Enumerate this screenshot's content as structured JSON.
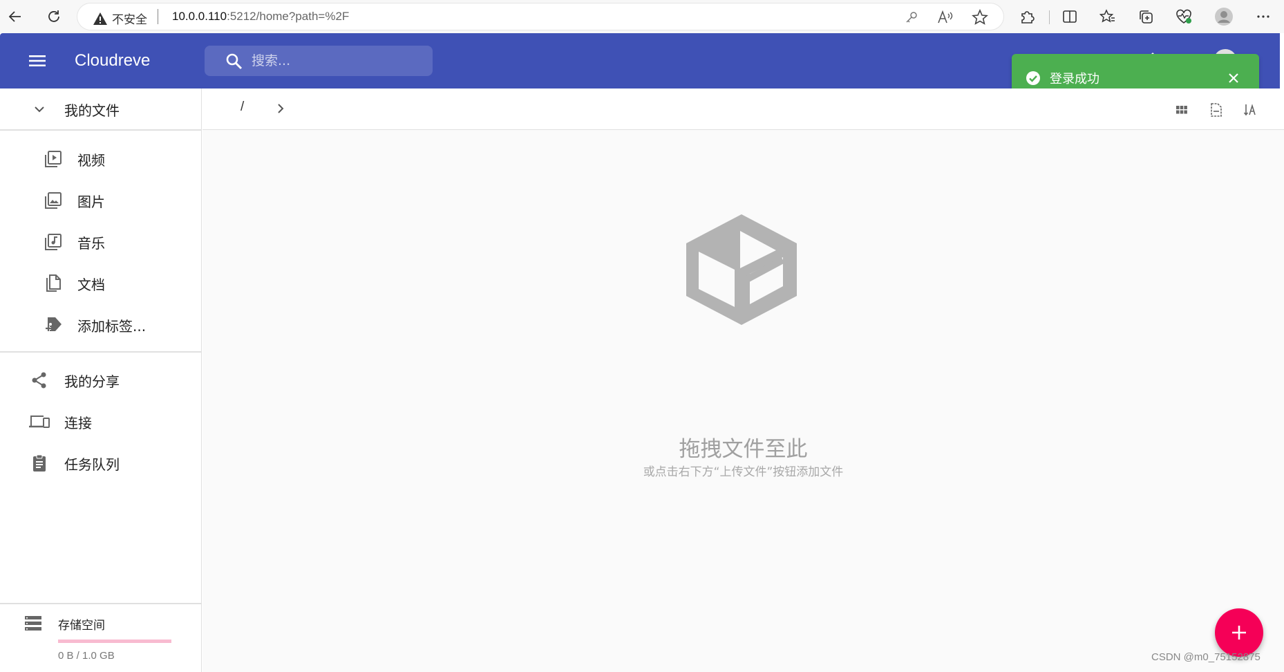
{
  "browser": {
    "insecure_label": "不安全",
    "url_host": "10.0.0.110",
    "url_rest": ":5212/home?path=%2F"
  },
  "appbar": {
    "brand": "Cloudreve",
    "search_placeholder": "搜索..."
  },
  "toast": {
    "message": "登录成功",
    "color": "#4caf50"
  },
  "sidebar": {
    "my_files": "我的文件",
    "items": [
      {
        "label": "视频",
        "icon": "video-library-icon"
      },
      {
        "label": "图片",
        "icon": "photo-library-icon"
      },
      {
        "label": "音乐",
        "icon": "library-music-icon"
      },
      {
        "label": "文档",
        "icon": "file-copy-icon"
      },
      {
        "label": "添加标签...",
        "icon": "add-tag-icon"
      }
    ],
    "sections": [
      {
        "label": "我的分享",
        "icon": "share-icon"
      },
      {
        "label": "连接",
        "icon": "devices-icon"
      },
      {
        "label": "任务队列",
        "icon": "assignment-icon"
      }
    ],
    "storage": {
      "label": "存储空间",
      "value": "0 B / 1.0 GB",
      "used_fraction": 0.0
    }
  },
  "main": {
    "breadcrumb_root": "/",
    "empty_title": "拖拽文件至此",
    "empty_subtitle": "或点击右下方“上传文件”按钮添加文件"
  },
  "colors": {
    "primary": "#3f51b5",
    "fab": "#f50057",
    "storage_bar": "#ec407a"
  },
  "watermark": "CSDN @m0_75152875"
}
